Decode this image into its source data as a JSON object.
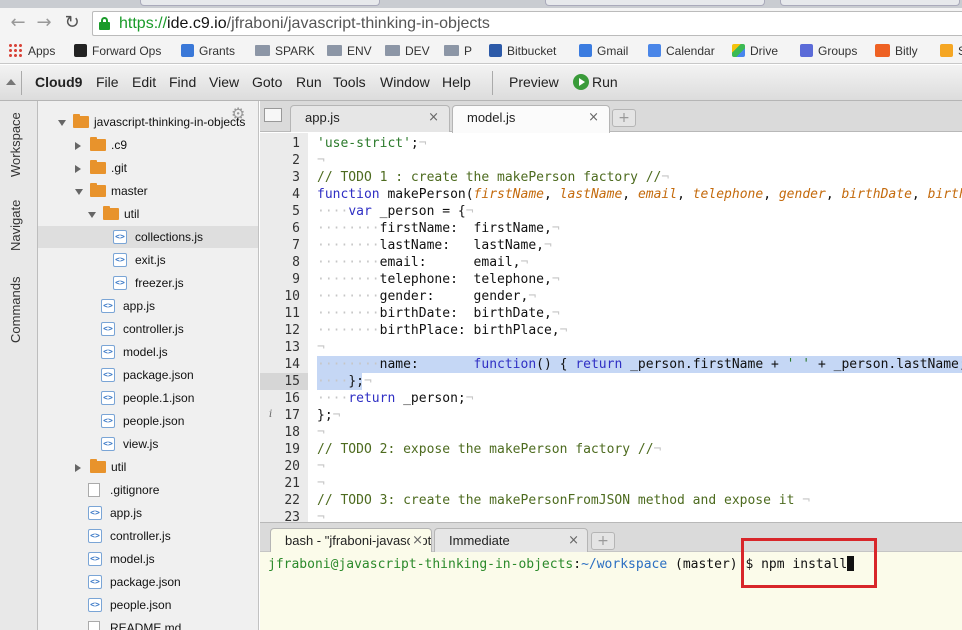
{
  "browser": {
    "url_scheme": "https://",
    "url_host": "ide.c9.io",
    "url_path": "/jfraboni/javascript-thinking-in-objects",
    "bookmarks": [
      {
        "label": "Apps",
        "icon": "apps-grid-icon"
      },
      {
        "label": "Forward Ops",
        "icon": "forward-ops-icon"
      },
      {
        "label": "Grants",
        "icon": "grants-icon"
      },
      {
        "label": "SPARK",
        "icon": "folder-icon"
      },
      {
        "label": "ENV",
        "icon": "folder-icon"
      },
      {
        "label": "DEV",
        "icon": "folder-icon"
      },
      {
        "label": "P",
        "icon": "folder-icon"
      },
      {
        "label": "Bitbucket",
        "icon": "bitbucket-icon"
      },
      {
        "label": "Gmail",
        "icon": "gmail-icon"
      },
      {
        "label": "Calendar",
        "icon": "calendar-icon"
      },
      {
        "label": "Drive",
        "icon": "drive-icon"
      },
      {
        "label": "Groups",
        "icon": "groups-icon"
      },
      {
        "label": "Bitly",
        "icon": "bitly-icon"
      },
      {
        "label": "S",
        "icon": "s-icon"
      }
    ]
  },
  "ide": {
    "brand": "Cloud9",
    "menus": [
      "File",
      "Edit",
      "Find",
      "View",
      "Goto",
      "Run",
      "Tools",
      "Window",
      "Help"
    ],
    "preview": "Preview",
    "run": "Run",
    "side_tabs": [
      "Workspace",
      "Navigate",
      "Commands"
    ]
  },
  "tree": {
    "items": [
      {
        "label": "javascript-thinking-in-objects",
        "kind": "folder",
        "state": "open"
      },
      {
        "label": ".c9",
        "kind": "folder",
        "state": "closed"
      },
      {
        "label": ".git",
        "kind": "folder",
        "state": "closed"
      },
      {
        "label": "master",
        "kind": "folder",
        "state": "open"
      },
      {
        "label": "util",
        "kind": "folder",
        "state": "open"
      },
      {
        "label": "collections.js",
        "kind": "js",
        "selected": true
      },
      {
        "label": "exit.js",
        "kind": "js"
      },
      {
        "label": "freezer.js",
        "kind": "js"
      },
      {
        "label": "app.js",
        "kind": "js"
      },
      {
        "label": "controller.js",
        "kind": "js"
      },
      {
        "label": "model.js",
        "kind": "js"
      },
      {
        "label": "package.json",
        "kind": "js"
      },
      {
        "label": "people.1.json",
        "kind": "js"
      },
      {
        "label": "people.json",
        "kind": "js"
      },
      {
        "label": "view.js",
        "kind": "js"
      },
      {
        "label": "util",
        "kind": "folder",
        "state": "closed"
      },
      {
        "label": ".gitignore",
        "kind": "text"
      },
      {
        "label": "app.js",
        "kind": "js"
      },
      {
        "label": "controller.js",
        "kind": "js"
      },
      {
        "label": "model.js",
        "kind": "js"
      },
      {
        "label": "package.json",
        "kind": "js"
      },
      {
        "label": "people.json",
        "kind": "js"
      },
      {
        "label": "README.md",
        "kind": "text"
      }
    ]
  },
  "editor": {
    "tabs": [
      {
        "label": "app.js",
        "active": false
      },
      {
        "label": "model.js",
        "active": true
      }
    ],
    "current_line": 15,
    "lines": [
      "'use-strict';¬",
      "¬",
      "// TODO 1 : create the makePerson factory //¬",
      "function makePerson(firstName, lastName, email, telephone, gender, birthDate, birthPlace) {¬",
      "    var _person = {¬",
      "        firstName:  firstName,¬",
      "        lastName:   lastName,¬",
      "        email:      email,¬",
      "        telephone:  telephone,¬",
      "        gender:     gender,¬",
      "        birthDate:  birthDate,¬",
      "        birthPlace: birthPlace,¬",
      "¬",
      "        name:       function() { return _person.firstName + ' ' + _person.lastName; }",
      "    };¬",
      "    return _person;¬",
      "};¬",
      "¬",
      "// TODO 2: expose the makePerson factory //¬",
      "¬",
      "¬",
      "// TODO 3: create the makePersonFromJSON method and expose it ¬",
      "¬"
    ]
  },
  "console": {
    "tabs": [
      {
        "label": "bash - \"jfraboni-javascript-thinking-in-objects\"",
        "active": true
      },
      {
        "label": "Immediate",
        "active": false
      }
    ],
    "prompt_user": "jfraboni@javascript-thinking-in-objects",
    "prompt_sep": ":",
    "prompt_path": "~/workspace",
    "prompt_branch": " (master)",
    "prompt_cmd": " $ npm install"
  },
  "colors": {
    "secure_green": "#1a9b2a",
    "selection_blue": "#c5d7f5",
    "callout_red": "#d8262a",
    "console_bg": "#fbfbea"
  }
}
